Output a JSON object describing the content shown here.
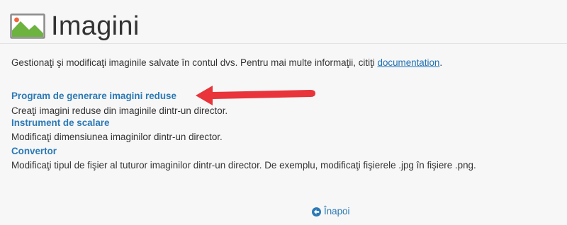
{
  "header": {
    "title": "Imagini",
    "icon": "image-landscape-icon"
  },
  "intro": {
    "text": "Gestionaţi şi modificaţi imaginile salvate în contul dvs. Pentru mai multe informaţii, citiţi ",
    "link_label": "documentation",
    "suffix": "."
  },
  "tools": [
    {
      "label": "Program de generare imagini reduse",
      "description": "Creaţi imagini reduse din imaginile dintr-un director."
    },
    {
      "label": "Instrument de scalare",
      "description": "Modificaţi dimensiunea imaginilor dintr-un director."
    },
    {
      "label": "Convertor",
      "description": "Modificaţi tipul de fişier al tuturor imaginilor dintr-un director. De exemplu, modificaţi fişierele .jpg în fişiere .png."
    }
  ],
  "back": {
    "label": "Înapoi",
    "icon": "arrow-circle-left-icon"
  },
  "colors": {
    "link": "#2b79b5",
    "annotation_arrow": "#e8343a",
    "icon_green": "#6db33f",
    "icon_sun": "#f0643c"
  }
}
